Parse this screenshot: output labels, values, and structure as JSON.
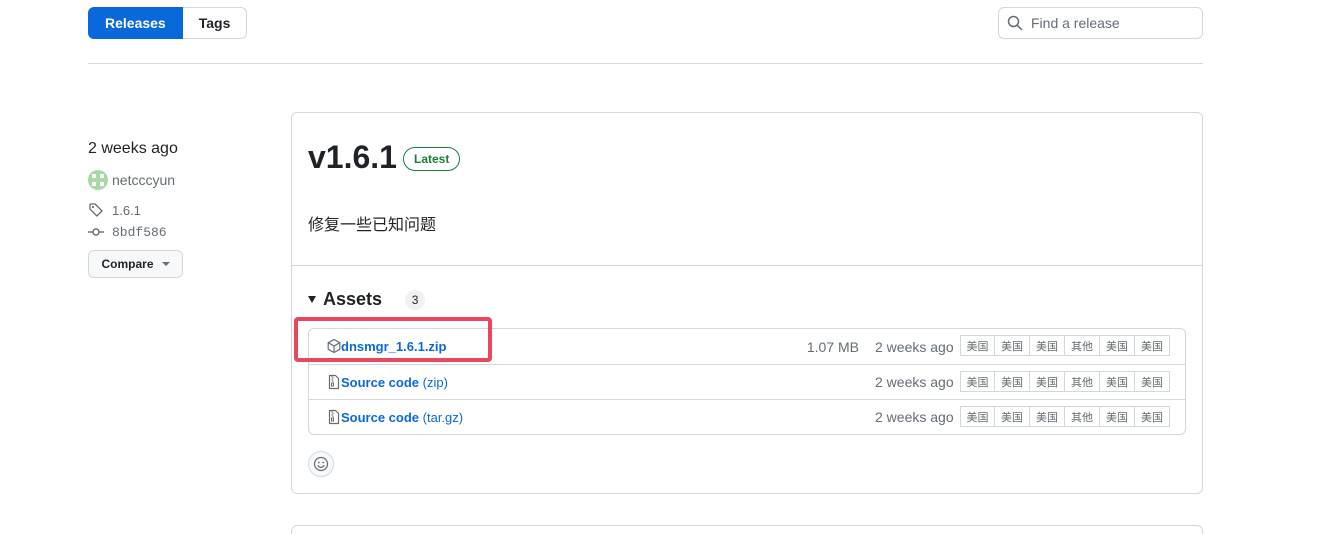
{
  "tabs": {
    "releases": "Releases",
    "tags": "Tags"
  },
  "search": {
    "placeholder": "Find a release"
  },
  "sidebar": {
    "time": "2 weeks ago",
    "author": "netcccyun",
    "tag": "1.6.1",
    "commit": "8bdf586",
    "compare_label": "Compare"
  },
  "release": {
    "version": "v1.6.1",
    "badge": "Latest",
    "description": "修复一些已知问题"
  },
  "assets": {
    "label": "Assets",
    "count": "3",
    "items": [
      {
        "name": "dnsmgr_1.6.1.zip",
        "ext": "",
        "size": "1.07 MB",
        "ago": "2 weeks ago",
        "icon": "package-icon"
      },
      {
        "name": "Source code",
        "ext": " (zip)",
        "size": "",
        "ago": "2 weeks ago",
        "icon": "file-zip-icon"
      },
      {
        "name": "Source code",
        "ext": " (tar.gz)",
        "size": "",
        "ago": "2 weeks ago",
        "icon": "file-zip-icon"
      }
    ],
    "mirrors": [
      "美国",
      "美国",
      "美国",
      "其他",
      "美国",
      "美国"
    ]
  },
  "colors": {
    "accent": "#0969da",
    "success": "#1a7f37",
    "highlight": "#e8475f"
  }
}
